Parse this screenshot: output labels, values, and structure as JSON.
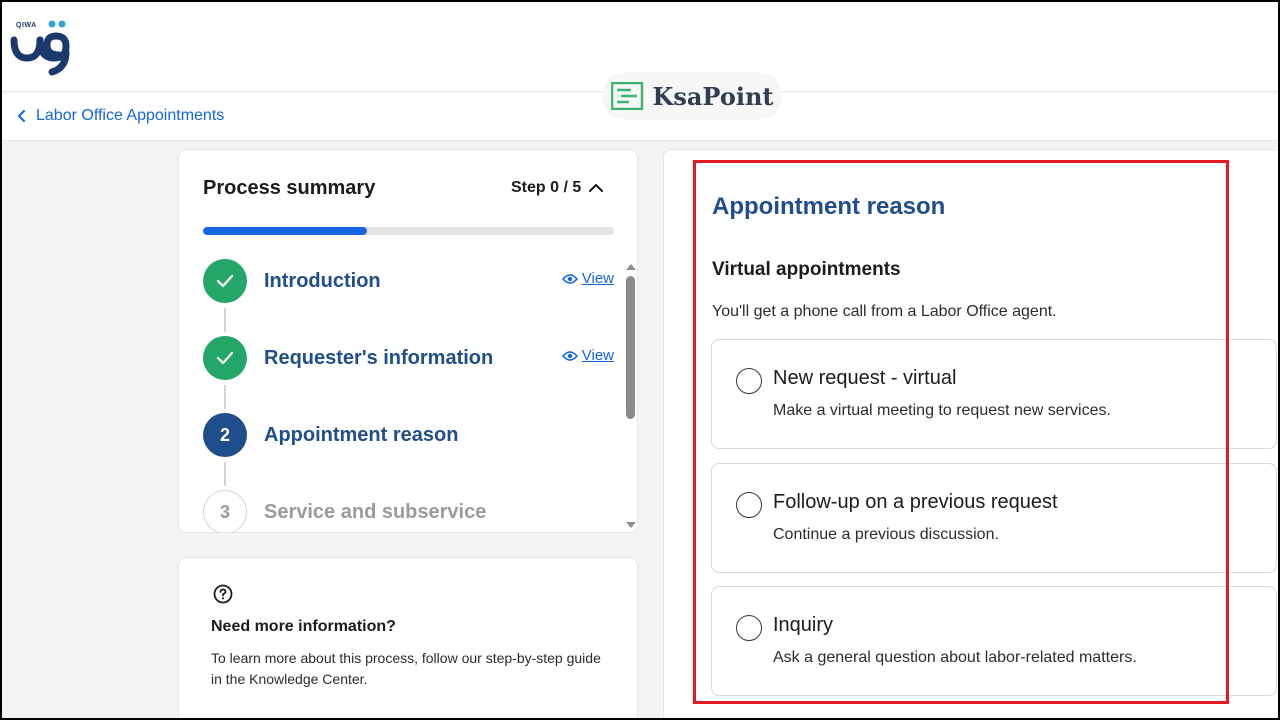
{
  "brand": {
    "logo_text": "QIWA"
  },
  "watermark": {
    "text": "KsaPoint"
  },
  "breadcrumb": {
    "label": "Labor Office Appointments"
  },
  "summary": {
    "title": "Process summary",
    "step_count": "Step 0 / 5",
    "progress": 0.4,
    "steps": [
      {
        "number": "",
        "label": "Introduction",
        "status": "done",
        "view_label": "View"
      },
      {
        "number": "",
        "label": "Requester's information",
        "status": "done",
        "view_label": "View"
      },
      {
        "number": "2",
        "label": "Appointment reason",
        "status": "current",
        "view_label": ""
      },
      {
        "number": "3",
        "label": "Service and subservice",
        "status": "pending",
        "view_label": ""
      }
    ]
  },
  "info": {
    "title": "Need more information?",
    "text": "To learn more about this process, follow our step-by-step guide in the Knowledge Center."
  },
  "main": {
    "title": "Appointment reason",
    "section_title": "Virtual appointments",
    "section_desc": "You'll get a phone call from a Labor Office agent.",
    "options": [
      {
        "title": "New request - virtual",
        "desc": "Make a virtual meeting to request new services."
      },
      {
        "title": "Follow-up on a previous request",
        "desc": "Continue a previous discussion."
      },
      {
        "title": "Inquiry",
        "desc": "Ask a general question about labor-related matters."
      }
    ]
  },
  "colors": {
    "accent": "#1565e0",
    "heading": "#1f4e8a",
    "done": "#24a669",
    "highlight": "#e01b24"
  }
}
